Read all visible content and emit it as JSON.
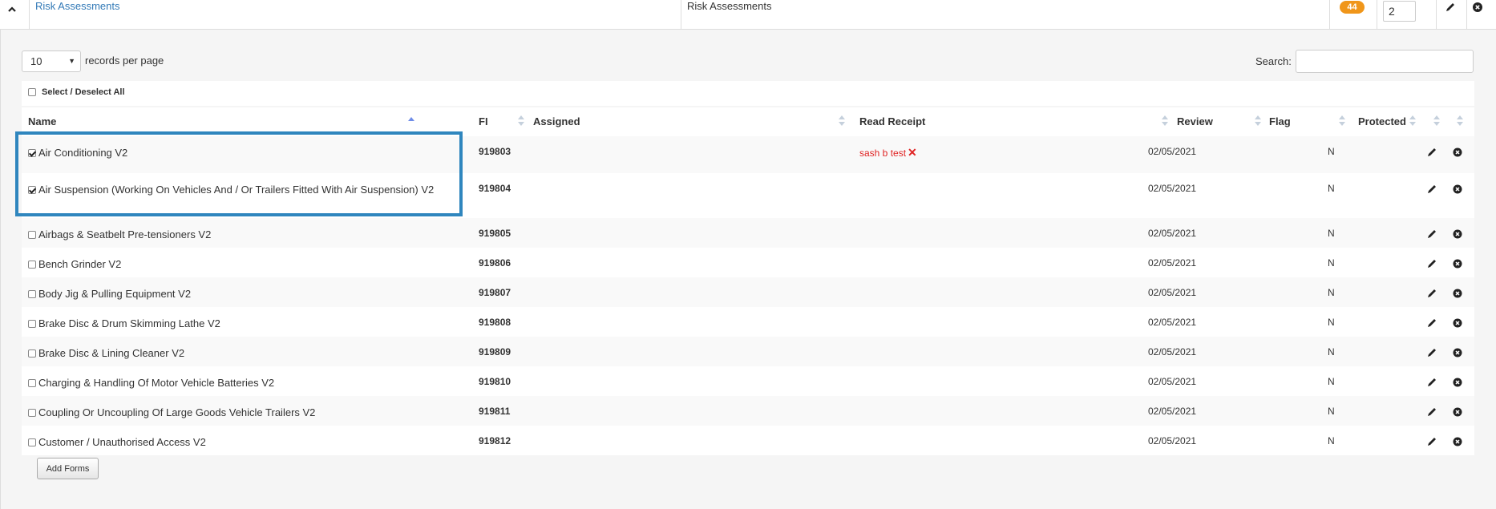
{
  "header": {
    "link_text": "Risk Assessments",
    "title": "Risk Assessments",
    "badge_count": "44",
    "number_value": "2"
  },
  "controls": {
    "page_length": "10",
    "page_length_label": "records per page",
    "search_label": "Search:",
    "search_value": "",
    "select_all_label": "Select / Deselect All"
  },
  "columns": {
    "name": "Name",
    "fi": "FI",
    "assigned": "Assigned",
    "read_receipt": "Read Receipt",
    "review": "Review",
    "flag": "Flag",
    "protected": "Protected"
  },
  "rows": [
    {
      "name": "Air Conditioning V2",
      "fi": "919803",
      "read_receipt": "sash b test",
      "review": "02/05/2021",
      "protected": "N",
      "checked": true
    },
    {
      "name": "Air Suspension (Working On Vehicles And / Or Trailers Fitted With Air Suspension) V2",
      "fi": "919804",
      "read_receipt": "",
      "review": "02/05/2021",
      "protected": "N",
      "checked": true
    },
    {
      "name": "Airbags & Seatbelt Pre-tensioners V2",
      "fi": "919805",
      "read_receipt": "",
      "review": "02/05/2021",
      "protected": "N",
      "checked": false
    },
    {
      "name": "Bench Grinder V2",
      "fi": "919806",
      "read_receipt": "",
      "review": "02/05/2021",
      "protected": "N",
      "checked": false
    },
    {
      "name": "Body Jig & Pulling Equipment V2",
      "fi": "919807",
      "read_receipt": "",
      "review": "02/05/2021",
      "protected": "N",
      "checked": false
    },
    {
      "name": "Brake Disc & Drum Skimming Lathe V2",
      "fi": "919808",
      "read_receipt": "",
      "review": "02/05/2021",
      "protected": "N",
      "checked": false
    },
    {
      "name": "Brake Disc & Lining Cleaner V2",
      "fi": "919809",
      "read_receipt": "",
      "review": "02/05/2021",
      "protected": "N",
      "checked": false
    },
    {
      "name": "Charging & Handling Of Motor Vehicle Batteries V2",
      "fi": "919810",
      "read_receipt": "",
      "review": "02/05/2021",
      "protected": "N",
      "checked": false
    },
    {
      "name": "Coupling Or Uncoupling Of Large Goods Vehicle Trailers V2",
      "fi": "919811",
      "read_receipt": "",
      "review": "02/05/2021",
      "protected": "N",
      "checked": false
    },
    {
      "name": "Customer / Unauthorised Access V2",
      "fi": "919812",
      "read_receipt": "",
      "review": "02/05/2021",
      "protected": "N",
      "checked": false
    }
  ],
  "footer": {
    "add_forms_label": "Add Forms"
  },
  "icons": {
    "collapse": "chevron-up-icon",
    "edit": "pencil-icon",
    "remove": "circle-x-icon"
  },
  "colors": {
    "link": "#337ab7",
    "badge": "#f0961a",
    "highlight_border": "#2f86be",
    "read_receipt": "#e02424"
  }
}
